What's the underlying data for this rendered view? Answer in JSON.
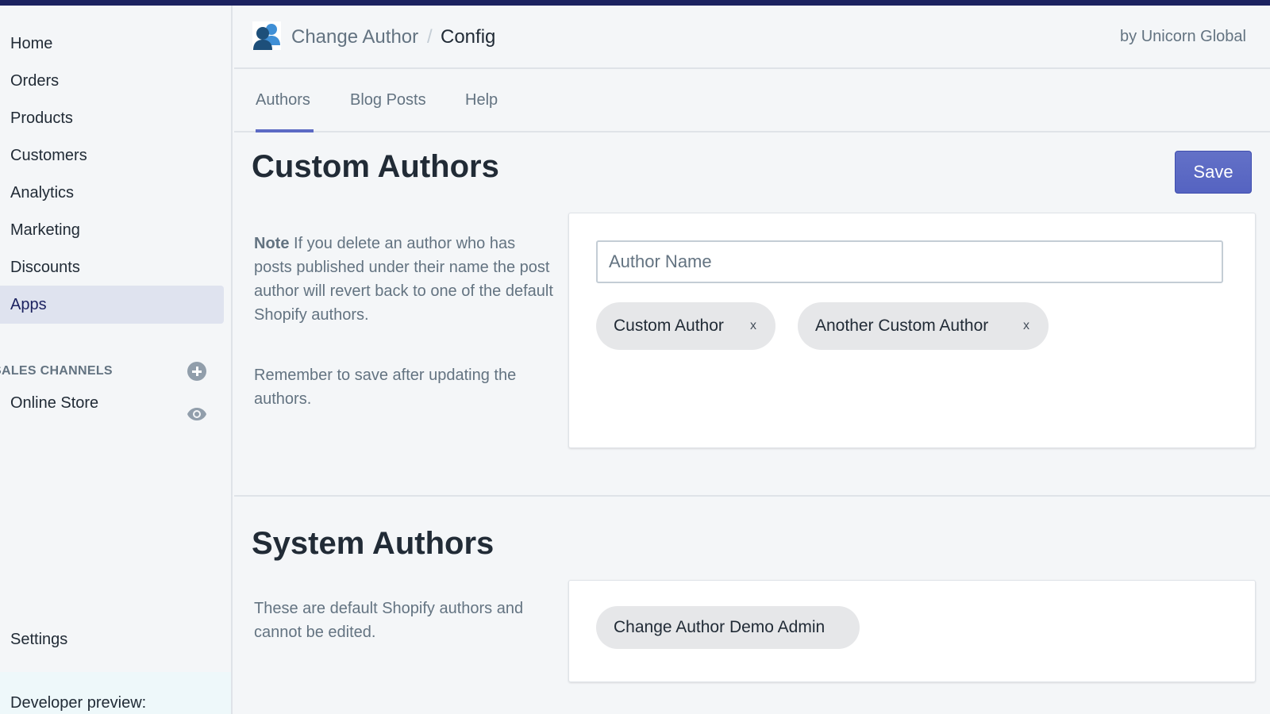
{
  "sidebar": {
    "items": [
      {
        "label": "Home"
      },
      {
        "label": "Orders"
      },
      {
        "label": "Products"
      },
      {
        "label": "Customers"
      },
      {
        "label": "Analytics"
      },
      {
        "label": "Marketing"
      },
      {
        "label": "Discounts"
      },
      {
        "label": "Apps"
      }
    ],
    "channels_label": "SALES CHANNELS",
    "online_store": "Online Store",
    "settings": "Settings",
    "developer_preview": "Developer preview:"
  },
  "header": {
    "app_name": "Change Author",
    "separator": "/",
    "page": "Config",
    "by_line": "by Unicorn Global"
  },
  "tabs": [
    {
      "label": "Authors"
    },
    {
      "label": "Blog Posts"
    },
    {
      "label": "Help"
    }
  ],
  "custom_authors": {
    "title": "Custom Authors",
    "save_label": "Save",
    "note_label": "Note",
    "note_text": " If you delete an author who has posts published under their name the post author will revert back to one of the default Shopify authors.",
    "reminder": "Remember to save after updating the authors.",
    "input_placeholder": "Author Name",
    "tags": [
      {
        "label": "Custom Author",
        "remove": "x"
      },
      {
        "label": "Another Custom Author",
        "remove": "x"
      }
    ]
  },
  "system_authors": {
    "title": "System Authors",
    "description": "These are default Shopify authors and cannot be edited.",
    "tags": [
      {
        "label": "Change Author Demo Admin"
      }
    ]
  },
  "colors": {
    "top_bar": "#1c2260",
    "accent": "#5c6ac4",
    "active_nav_bg": "#dfe3ef"
  }
}
